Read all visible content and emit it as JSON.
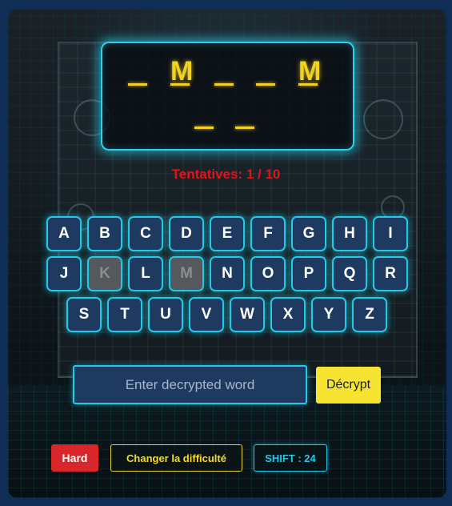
{
  "game": {
    "word_slots": [
      {
        "char": "",
        "row": 1
      },
      {
        "char": "M",
        "row": 1
      },
      {
        "char": "",
        "row": 1
      },
      {
        "char": "",
        "row": 1
      },
      {
        "char": "M",
        "row": 1
      },
      {
        "char": "",
        "row": 2
      },
      {
        "char": "",
        "row": 2
      }
    ],
    "attempts_text": "Tentatives: 1 / 10",
    "keyboard": {
      "row1": [
        "A",
        "B",
        "C",
        "D",
        "E",
        "F",
        "G",
        "H",
        "I"
      ],
      "row2": [
        "J",
        "K",
        "L",
        "M",
        "N",
        "O",
        "P",
        "Q",
        "R"
      ],
      "row3": [
        "S",
        "T",
        "U",
        "V",
        "W",
        "X",
        "Y",
        "Z"
      ],
      "used_letters": [
        "K",
        "M"
      ]
    },
    "guess_input": {
      "placeholder": "Enter decrypted word",
      "value": ""
    },
    "decrypt_label": "Décrypt",
    "difficulty_label": "Hard",
    "change_difficulty_label": "Changer la difficulté",
    "shift_label": "SHIFT : 24"
  },
  "colors": {
    "accent_cyan": "#23c9e6",
    "key_bg": "#1f3a60",
    "letter_yellow": "#f2d21e",
    "attempts_red": "#e0141a",
    "hard_red": "#d9262b",
    "decrypt_yellow": "#f6e332",
    "page_bg": "#0f2d55"
  }
}
